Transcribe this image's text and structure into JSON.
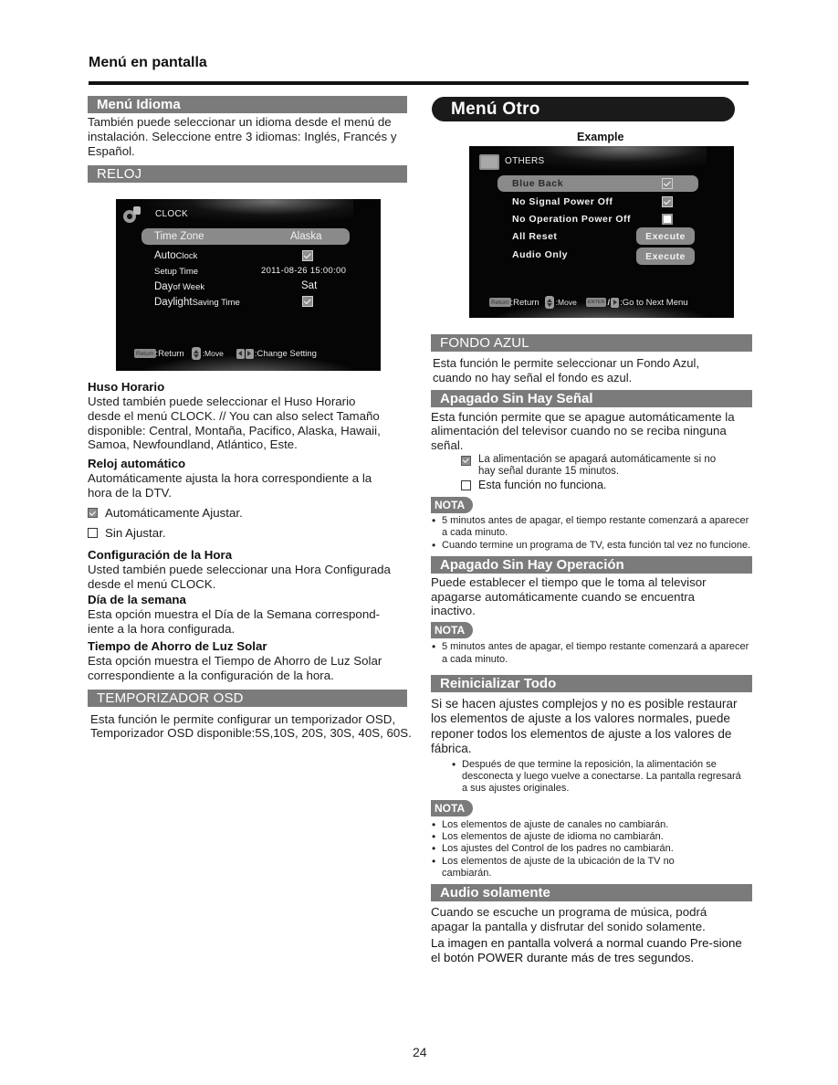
{
  "header": {
    "title": "Menú en pantalla"
  },
  "left": {
    "idioma": {
      "heading": "Menú Idioma",
      "text": "También puede seleccionar un idioma desde el menú de instalación. Seleccione entre 3 idiomas: Inglés, Francés y Español."
    },
    "reloj": {
      "heading": "RELOJ"
    },
    "clock_osd": {
      "title": "CLOCK",
      "icon": "gear-icon",
      "rows": [
        {
          "label_big": "Time Zone",
          "label_small": "",
          "value": "Alaska",
          "type": "text",
          "highlighted": true
        },
        {
          "label_big": "Auto",
          "label_small": " Clock",
          "value": "checked",
          "type": "checkbox",
          "highlighted": false
        },
        {
          "label_big": "",
          "label_small": "Setup Time",
          "value": "2011-08-26 15:00:00",
          "type": "text",
          "highlighted": false
        },
        {
          "label_big": "Day",
          "label_small": " of Week",
          "value": "Sat",
          "type": "text",
          "highlighted": false
        },
        {
          "label_big": "Daylight",
          "label_small": " Saving Time",
          "value": "checked",
          "type": "checkbox",
          "highlighted": false
        }
      ],
      "footer": {
        "return_key": "Return",
        "return_label": ":Return",
        "move_label": ":Move",
        "change_label": ":Change  Setting"
      }
    },
    "huso": {
      "heading": "Huso Horario",
      "text": "Usted también puede seleccionar el Huso Horario desde el menú CLOCK. // You can also select Tamaño disponible: Central, Montaña, Pacifico, Alaska, Hawaii, Samoa, Newfoundland, Atlántico, Este."
    },
    "reloj_auto": {
      "heading": "Reloj automático",
      "text": "Automáticamente ajusta la hora correspondiente a la hora de la DTV.",
      "options": [
        {
          "label": "Automáticamente  Ajustar.",
          "checked": true
        },
        {
          "label": "Sin  Ajustar.",
          "checked": false
        }
      ]
    },
    "config_hora": {
      "heading": "Configuración de la Hora",
      "text": "Usted también puede seleccionar una Hora Configurada desde el menú CLOCK."
    },
    "dia_semana": {
      "heading": "Día de la semana",
      "text": "Esta opción muestra el Día de la Semana correspond-iente a la hora configurada."
    },
    "ahorro": {
      "heading": "Tiempo de Ahorro de Luz Solar",
      "text": "Esta opción muestra el Tiempo de Ahorro de Luz Solar correspondiente a la configuración de la hora."
    },
    "osd_timer": {
      "heading": "TEMPORIZADOR OSD",
      "text": "Esta función le permite configurar un temporizador OSD, Temporizador OSD disponible:5S,10S, 20S, 30S, 40S, 60S."
    }
  },
  "right": {
    "menu_title": "Menú  Otro",
    "example_label": "Example",
    "others_osd": {
      "title": "OTHERS",
      "icon": "folder-icon",
      "rows": [
        {
          "label": "Blue Back",
          "type": "checkbox",
          "checked": true,
          "highlighted": true
        },
        {
          "label": "No Signal Power Off",
          "type": "checkbox",
          "checked": true,
          "highlighted": false
        },
        {
          "label": "No Operation Power Off",
          "type": "checkbox",
          "checked": false,
          "highlighted": false
        },
        {
          "label": "All Reset",
          "type": "button",
          "button_label": "Execute",
          "highlighted": false
        },
        {
          "label": "Audio Only",
          "type": "button",
          "button_label": "Execute",
          "highlighted": false
        }
      ],
      "footer": {
        "return_key": "Return",
        "return_label": ":Return",
        "move_label": ":Move",
        "enter_key": "ENTER",
        "next_label": ":Go to Next Menu"
      }
    },
    "fondo_azul": {
      "heading": "FONDO AZUL",
      "text": "Esta función le permite seleccionar un Fondo Azul, cuando no hay señal el fondo es azul."
    },
    "sin_senal": {
      "heading": "Apagado Sin Hay Señal",
      "text": "Esta función permite que se apague automáticamente la alimentación del televisor cuando no se reciba ninguna señal.",
      "options": [
        {
          "label": "La alimentación se apagará automáticamente si no hay señal durante 15 minutos.",
          "checked": true
        },
        {
          "label": "Esta función no funciona.",
          "checked": false
        }
      ],
      "nota_label": "NOTA",
      "notes": [
        "5 minutos antes de apagar, el tiempo restante comenzará a aparecer a cada minuto.",
        "Cuando termine un programa de TV, esta función tal vez no funcione."
      ]
    },
    "sin_operacion": {
      "heading": "Apagado Sin Hay Operación",
      "text": "Puede establecer el tiempo que le toma al televisor apagarse automáticamente cuando se encuentra inactivo.",
      "nota_label": "NOTA",
      "notes": [
        "5 minutos antes de apagar, el tiempo restante comenzará a aparecer a cada minuto."
      ]
    },
    "reinicializar": {
      "heading": "Reinicializar Todo",
      "text": "Si se hacen ajustes complejos y no es posible restaurar los elementos de ajuste a los valores normales, puede reponer todos los elementos de ajuste a los valores de fábrica.",
      "sub_bullet": "Después de que termine la reposición, la alimentación se desconecta y luego vuelve a conectarse. La pantalla regresará a sus ajustes originales.",
      "nota_label": "NOTA",
      "notes": [
        "Los elementos de ajuste de canales no cambiarán.",
        "Los elementos de ajuste de idioma no cambiarán.",
        "Los ajustes del Control de los padres no cambiarán.",
        "Los elementos de ajuste de la ubicación de la TV no cambiarán."
      ]
    },
    "audio_solo": {
      "heading": "Audio solamente",
      "text": "Cuando se escuche un programa de música, podrá apagar la pantalla y disfrutar del sonido solamente.",
      "text2": "La imagen en pantalla volverá a normal cuando Pre-sione el botón POWER durante más de tres segundos."
    }
  },
  "footer": {
    "page_number": "24"
  }
}
